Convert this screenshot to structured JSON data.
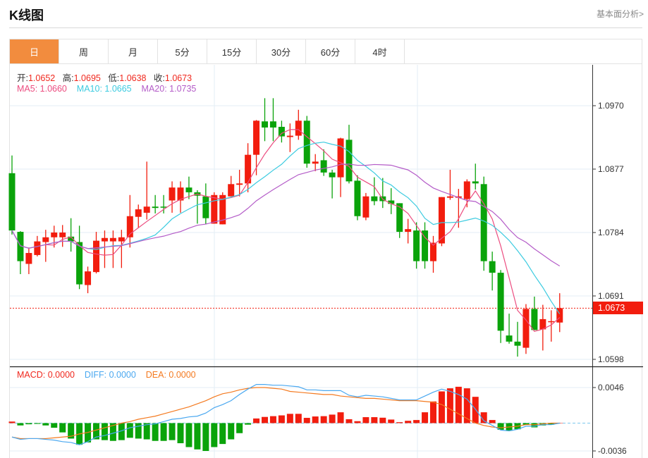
{
  "header": {
    "title": "K线图",
    "link": "基本面分析>"
  },
  "tabs": [
    {
      "label": "日",
      "active": true
    },
    {
      "label": "周"
    },
    {
      "label": "月"
    },
    {
      "label": "5分"
    },
    {
      "label": "15分"
    },
    {
      "label": "30分"
    },
    {
      "label": "60分"
    },
    {
      "label": "4时"
    }
  ],
  "ohlc_legend": {
    "open_label": "开:",
    "open": "1.0652",
    "high_label": "高:",
    "high": "1.0695",
    "low_label": "低:",
    "low": "1.0638",
    "close_label": "收:",
    "close": "1.0673"
  },
  "ma_legend": {
    "ma5": "MA5: 1.0660",
    "ma10": "MA10: 1.0665",
    "ma20": "MA20: 1.0735"
  },
  "macd_legend": {
    "macd": "MACD: 0.0000",
    "diff": "DIFF: 0.0000",
    "dea": "DEA: 0.0000"
  },
  "colors": {
    "up": "#f21d0e",
    "down": "#0aa30a",
    "ma5": "#ec4d80",
    "ma10": "#3ccbe0",
    "ma20": "#b45cc8",
    "diff": "#4aa8f0",
    "dea": "#f47a20",
    "accent": "#f28c3e"
  },
  "chart_data": [
    {
      "type": "candlestick",
      "title": "K线图 (日)",
      "ylim": [
        1.0598,
        1.097
      ],
      "yticks": [
        "1.0970",
        "1.0877",
        "1.0784",
        "1.0691",
        "1.0598"
      ],
      "current_price": "1.0673",
      "ma_periods": [
        5,
        10,
        20
      ],
      "ohlc": [
        [
          1.0871,
          1.0897,
          1.0781,
          1.0787
        ],
        [
          1.0785,
          1.0786,
          1.0723,
          1.0742
        ],
        [
          1.0738,
          1.0762,
          1.0723,
          1.0754
        ],
        [
          1.0751,
          1.0779,
          1.0749,
          1.0771
        ],
        [
          1.077,
          1.0788,
          1.0741,
          1.0777
        ],
        [
          1.0777,
          1.0794,
          1.0762,
          1.0784
        ],
        [
          1.0777,
          1.0795,
          1.0763,
          1.0784
        ],
        [
          1.0778,
          1.0805,
          1.0756,
          1.0771
        ],
        [
          1.077,
          1.0794,
          1.0701,
          1.0708
        ],
        [
          1.0707,
          1.0734,
          1.0695,
          1.0727
        ],
        [
          1.0726,
          1.0785,
          1.0724,
          1.0772
        ],
        [
          1.0771,
          1.0787,
          1.0732,
          1.0776
        ],
        [
          1.0771,
          1.0787,
          1.0732,
          1.0776
        ],
        [
          1.0771,
          1.0788,
          1.0732,
          1.0777
        ],
        [
          1.0777,
          1.0839,
          1.0762,
          1.0808
        ],
        [
          1.0807,
          1.0825,
          1.0791,
          1.0818
        ],
        [
          1.0813,
          1.0888,
          1.0803,
          1.0822
        ],
        [
          1.0822,
          1.0839,
          1.0812,
          1.082
        ],
        [
          1.0822,
          1.0839,
          1.0812,
          1.0821
        ],
        [
          1.0831,
          1.0859,
          1.0813,
          1.085
        ],
        [
          1.0831,
          1.0859,
          1.0813,
          1.085
        ],
        [
          1.085,
          1.0866,
          1.0833,
          1.0843
        ],
        [
          1.0843,
          1.0846,
          1.0797,
          1.0838
        ],
        [
          1.0837,
          1.0856,
          1.0796,
          1.0805
        ],
        [
          1.0797,
          1.0843,
          1.0797,
          1.0839
        ],
        [
          1.0796,
          1.0843,
          1.0796,
          1.0839
        ],
        [
          1.0837,
          1.0867,
          1.0837,
          1.0855
        ],
        [
          1.0854,
          1.0876,
          1.0837,
          1.0856
        ],
        [
          1.0856,
          1.0915,
          1.0843,
          1.0898
        ],
        [
          1.0898,
          1.0949,
          1.0868,
          1.0948
        ],
        [
          1.0947,
          1.0981,
          1.0918,
          1.0938
        ],
        [
          1.0947,
          1.0981,
          1.0918,
          1.0938
        ],
        [
          1.0939,
          1.0948,
          1.0916,
          1.0925
        ],
        [
          1.0924,
          1.0944,
          1.0902,
          1.0926
        ],
        [
          1.0926,
          1.0964,
          1.092,
          1.0948
        ],
        [
          1.0948,
          1.0955,
          1.0879,
          1.0885
        ],
        [
          1.0885,
          1.0899,
          1.0874,
          1.0888
        ],
        [
          1.089,
          1.0906,
          1.0867,
          1.0872
        ],
        [
          1.0872,
          1.0876,
          1.0834,
          1.0865
        ],
        [
          1.0865,
          1.0923,
          1.0836,
          1.0922
        ],
        [
          1.092,
          1.0942,
          1.0856,
          1.0859
        ],
        [
          1.086,
          1.0868,
          1.0802,
          1.0808
        ],
        [
          1.0806,
          1.0842,
          1.0802,
          1.0837
        ],
        [
          1.0837,
          1.0865,
          1.0824,
          1.083
        ],
        [
          1.0837,
          1.0864,
          1.082,
          1.083
        ],
        [
          1.0831,
          1.0849,
          1.0811,
          1.0826
        ],
        [
          1.0827,
          1.0827,
          1.0776,
          1.0785
        ],
        [
          1.0785,
          1.0804,
          1.0768,
          1.0789
        ],
        [
          1.0787,
          1.0799,
          1.0731,
          1.0742
        ],
        [
          1.0787,
          1.0799,
          1.0731,
          1.0742
        ],
        [
          1.0742,
          1.0779,
          1.0725,
          1.0769
        ],
        [
          1.0768,
          1.0836,
          1.0764,
          1.0836
        ],
        [
          1.0835,
          1.0876,
          1.0832,
          1.0837
        ],
        [
          1.0835,
          1.0848,
          1.0791,
          1.0837
        ],
        [
          1.0833,
          1.0862,
          1.0821,
          1.0859
        ],
        [
          1.0859,
          1.0885,
          1.0847,
          1.0856
        ],
        [
          1.0855,
          1.0866,
          1.0728,
          1.0742
        ],
        [
          1.0742,
          1.0756,
          1.0699,
          1.0725
        ],
        [
          1.0725,
          1.0729,
          1.0622,
          1.064
        ],
        [
          1.0633,
          1.0665,
          1.0621,
          1.0624
        ],
        [
          1.0624,
          1.0653,
          1.0602,
          1.0618
        ],
        [
          1.0615,
          1.0679,
          1.0606,
          1.0672
        ],
        [
          1.0672,
          1.069,
          1.0641,
          1.0641
        ],
        [
          1.0642,
          1.0678,
          1.0611,
          1.0657
        ],
        [
          1.0653,
          1.067,
          1.0624,
          1.0654
        ],
        [
          1.0652,
          1.0695,
          1.0638,
          1.0673
        ]
      ]
    },
    {
      "type": "bar+line",
      "title": "MACD",
      "ylim": [
        -0.0036,
        0.0046
      ],
      "yticks": [
        "0.0046",
        "-0.0036"
      ],
      "macd": [
        0.0002,
        -0.0003,
        -0.00015,
        -0.0001,
        -0.0003,
        -0.0006,
        -0.0012,
        -0.002,
        -0.0028,
        -0.0025,
        -0.0021,
        -0.0022,
        -0.0023,
        -0.0022,
        -0.0019,
        -0.002,
        -0.0021,
        -0.0023,
        -0.0023,
        -0.0022,
        -0.0026,
        -0.0031,
        -0.0034,
        -0.0036,
        -0.0031,
        -0.0027,
        -0.0021,
        -0.0013,
        -0.0002,
        0.0006,
        0.0008,
        0.0009,
        0.001,
        0.0012,
        0.0012,
        0.00068,
        0.00086,
        0.0009,
        0.0011,
        0.0014,
        0.0005,
        0.00025,
        0.00077,
        0.00077,
        0.0007,
        0.00046,
        0.00012,
        0.0003,
        0.0004,
        0.0014,
        0.0028,
        0.0041,
        0.0045,
        0.0047,
        0.0045,
        0.0034,
        0.0014,
        0.0004,
        -0.00086,
        -0.001,
        -0.0008,
        -0.0002,
        -0.00055,
        -0.0003,
        -0.0002,
        0.0
      ],
      "diff": [
        -0.0018,
        -0.0021,
        -0.002,
        -0.002,
        -0.0021,
        -0.0022,
        -0.0024,
        -0.0025,
        -0.0028,
        -0.0024,
        -0.0018,
        -0.0016,
        -0.0013,
        -0.001,
        -0.0006,
        -0.0004,
        -0.0002,
        -0.0001,
        0.0002,
        0.0005,
        0.0006,
        0.0008,
        0.0009,
        0.0013,
        0.002,
        0.0024,
        0.0029,
        0.0037,
        0.0044,
        0.005,
        0.005,
        0.0049,
        0.0049,
        0.0048,
        0.0047,
        0.0043,
        0.0043,
        0.0042,
        0.0042,
        0.0042,
        0.0036,
        0.0034,
        0.0036,
        0.0035,
        0.0034,
        0.0032,
        0.003,
        0.003,
        0.003,
        0.0035,
        0.004,
        0.0044,
        0.0041,
        0.0037,
        0.0031,
        0.0018,
        0.0003,
        -0.0003,
        -0.0009,
        -0.001,
        -0.0008,
        -0.0004,
        -0.0004,
        -0.0002,
        -0.0002,
        0.0
      ],
      "dea": [
        -0.0018,
        -0.002,
        -0.002,
        -0.002,
        -0.002,
        -0.0019,
        -0.0018,
        -0.0017,
        -0.0014,
        -0.0012,
        -0.0009,
        -0.0006,
        -0.0003,
        0.0,
        0.0002,
        0.0005,
        0.0007,
        0.0009,
        0.0012,
        0.0015,
        0.0018,
        0.0021,
        0.0025,
        0.0029,
        0.0034,
        0.0038,
        0.004,
        0.0043,
        0.0045,
        0.0046,
        0.0046,
        0.0045,
        0.0044,
        0.0041,
        0.004,
        0.0039,
        0.0038,
        0.0037,
        0.0037,
        0.0035,
        0.0034,
        0.0033,
        0.0032,
        0.0032,
        0.0031,
        0.003,
        0.0029,
        0.0029,
        0.0029,
        0.0028,
        0.0027,
        0.0024,
        0.0018,
        0.0012,
        0.0006,
        0.0,
        -0.0003,
        -0.0005,
        -0.0006,
        -0.0005,
        -0.0004,
        -0.0002,
        -0.0002,
        -0.0001,
        0.0,
        0.0
      ]
    }
  ]
}
